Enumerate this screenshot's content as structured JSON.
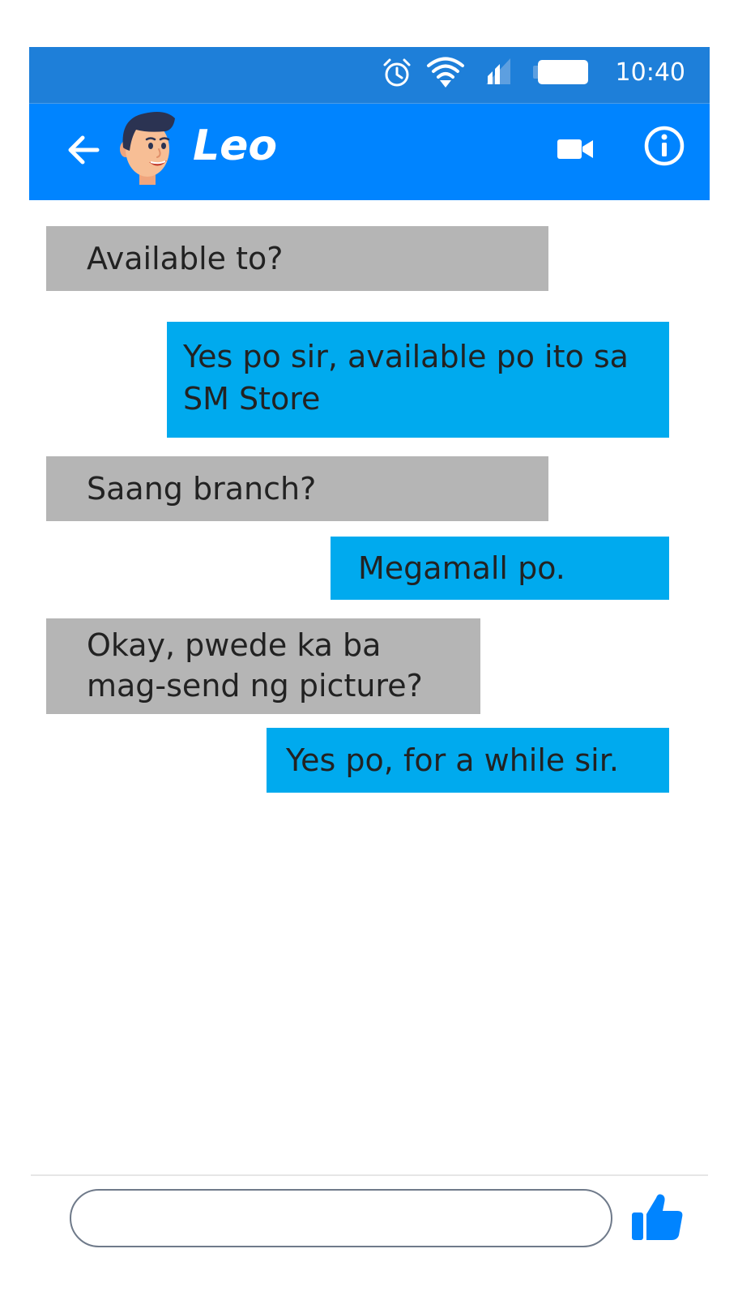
{
  "status_bar": {
    "time": "10:40",
    "icons": [
      "alarm-icon",
      "wifi-icon",
      "signal-icon",
      "battery-icon"
    ],
    "color": "#1e7fd9"
  },
  "header": {
    "contact_name": "Leo",
    "color": "#0084ff",
    "icons": [
      "back-arrow-icon",
      "avatar",
      "video-call-icon",
      "info-icon"
    ]
  },
  "messages": [
    {
      "direction": "incoming",
      "lines": [
        "Available to?"
      ]
    },
    {
      "direction": "outgoing",
      "lines": [
        "Yes po sir, available po ito sa",
        "SM Store"
      ]
    },
    {
      "direction": "incoming",
      "lines": [
        "Saang branch?"
      ]
    },
    {
      "direction": "outgoing",
      "lines": [
        "Megamall po."
      ]
    },
    {
      "direction": "incoming",
      "lines": [
        "Okay, pwede ka ba",
        "mag-send ng picture?"
      ]
    },
    {
      "direction": "outgoing",
      "lines": [
        "Yes po, for a while sir."
      ]
    }
  ],
  "colors": {
    "incoming_bubble": "#b5b5b5",
    "outgoing_bubble": "#00aaee",
    "like_button": "#0084ff"
  },
  "composer": {
    "value": "",
    "placeholder": ""
  }
}
